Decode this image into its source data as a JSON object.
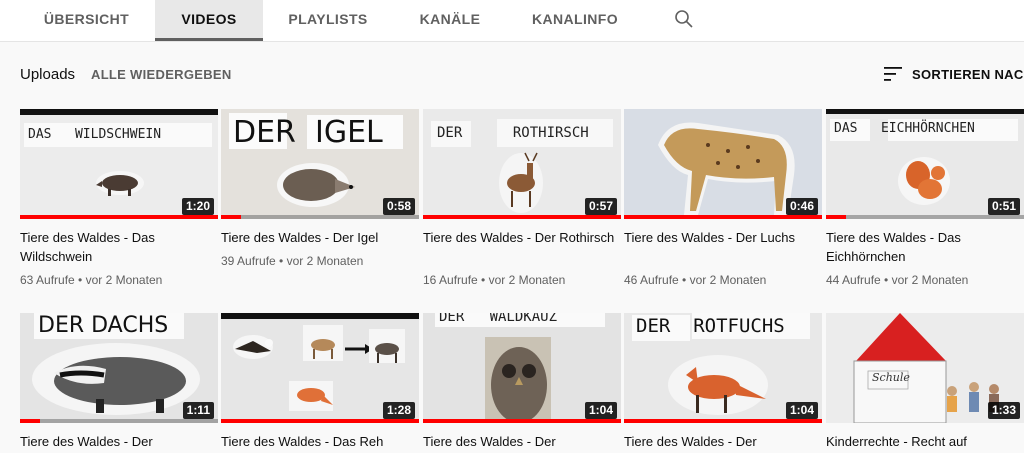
{
  "tabs": [
    {
      "label": "ÜBERSICHT",
      "active": false
    },
    {
      "label": "VIDEOS",
      "active": true
    },
    {
      "label": "PLAYLISTS",
      "active": false
    },
    {
      "label": "KANÄLE",
      "active": false
    },
    {
      "label": "KANALINFO",
      "active": false
    }
  ],
  "search_icon": "search-icon",
  "section": {
    "title": "Uploads",
    "play_all": "ALLE WIEDERGEBEN",
    "sort_label": "SORTIEREN NACH",
    "sort_icon": "sort-icon"
  },
  "colors": {
    "progress": "#ff0000",
    "active_tab_underline": "#606060"
  },
  "videos": [
    {
      "thumb_text": "DAS   WILDSCHWEIN",
      "duration": "1:20",
      "progress": 1.0,
      "title": "Tiere des Waldes - Das Wildschwein",
      "meta": "63 Aufrufe • vor 2 Monaten"
    },
    {
      "thumb_text": "DER  IGEL",
      "duration": "0:58",
      "progress": 0.1,
      "title": "Tiere des Waldes - Der Igel",
      "meta": "39 Aufrufe • vor 2 Monaten"
    },
    {
      "thumb_text": "DER      ROTHIRSCH",
      "duration": "0:57",
      "progress": 1.0,
      "title": "Tiere des Waldes - Der Rothirsch",
      "meta": "16 Aufrufe • vor 2 Monaten"
    },
    {
      "thumb_text": "",
      "duration": "0:46",
      "progress": 1.0,
      "title": "Tiere des Waldes - Der Luchs",
      "meta": "46 Aufrufe • vor 2 Monaten"
    },
    {
      "thumb_text": "DAS   EICHHÖRNCHEN",
      "duration": "0:51",
      "progress": 0.1,
      "title": "Tiere des Waldes - Das Eichhörnchen",
      "meta": "44 Aufrufe • vor 2 Monaten"
    },
    {
      "thumb_text": "DER DACHS",
      "duration": "1:11",
      "progress": 0.1,
      "title": "Tiere des Waldes - Der",
      "meta": ""
    },
    {
      "thumb_text": "",
      "duration": "1:28",
      "progress": 1.0,
      "title": "Tiere des Waldes - Das Reh",
      "meta": ""
    },
    {
      "thumb_text": "DER   WALDKAUZ",
      "duration": "1:04",
      "progress": 1.0,
      "title": "Tiere des Waldes - Der",
      "meta": ""
    },
    {
      "thumb_text": "DER  ROTFUCHS",
      "duration": "1:04",
      "progress": 1.0,
      "title": "Tiere des Waldes - Der",
      "meta": ""
    },
    {
      "thumb_text": "Schule",
      "duration": "1:33",
      "progress": 0.0,
      "title": "Kinderrechte - Recht auf",
      "meta": ""
    }
  ]
}
